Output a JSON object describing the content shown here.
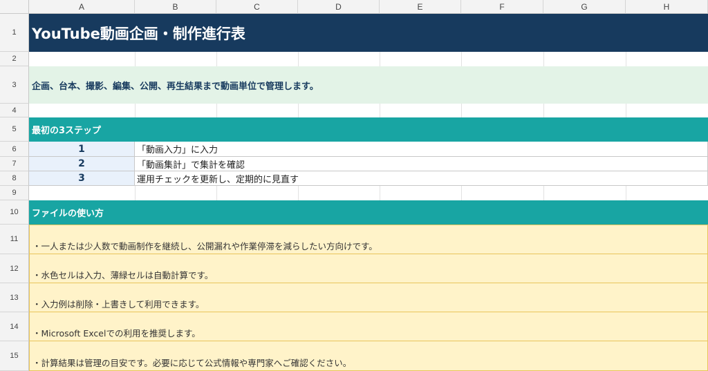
{
  "columns": [
    "A",
    "B",
    "C",
    "D",
    "E",
    "F",
    "G",
    "H"
  ],
  "rows": [
    "1",
    "2",
    "3",
    "4",
    "5",
    "6",
    "7",
    "8",
    "9",
    "10",
    "11",
    "12",
    "13",
    "14",
    "15"
  ],
  "title": "YouTube動画企画・制作進行表",
  "subtitle": "企画、台本、撮影、編集、公開、再生結果まで動画単位で管理します。",
  "steps_section": {
    "heading": "最初の3ステップ",
    "steps": [
      {
        "num": "1",
        "text": "「動画入力」に入力"
      },
      {
        "num": "2",
        "text": "「動画集計」で集計を確認"
      },
      {
        "num": "3",
        "text": "運用チェックを更新し、定期的に見直す"
      }
    ]
  },
  "usage_section": {
    "heading": "ファイルの使い方",
    "notes": [
      "・一人または少人数で動画制作を継続し、公開漏れや作業停滞を減らしたい方向けです。",
      "・水色セルは入力、薄緑セルは自動計算です。",
      "・入力例は削除・上書きして利用できます。",
      "・Microsoft Excelでの利用を推奨します。",
      "・計算結果は管理の目安です。必要に応じて公式情報や専門家へご確認ください。"
    ]
  },
  "colors": {
    "title_bg": "#173a5e",
    "subtitle_bg": "#e3f3e7",
    "section_bg": "#18a5a3",
    "step_num_bg": "#e9f1fb",
    "note_bg": "#fff3c9"
  }
}
